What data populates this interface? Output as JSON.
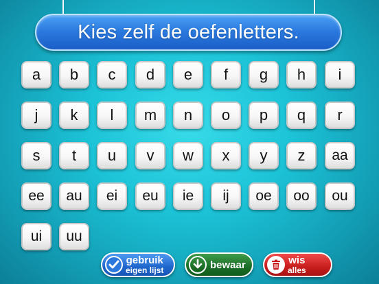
{
  "title": "Kies zelf de oefenletters.",
  "letters": [
    [
      "a",
      "b",
      "c",
      "d",
      "e",
      "f",
      "g",
      "h",
      "i"
    ],
    [
      "j",
      "k",
      "l",
      "m",
      "n",
      "o",
      "p",
      "q",
      "r"
    ],
    [
      "s",
      "t",
      "u",
      "v",
      "w",
      "x",
      "y",
      "z",
      "aa"
    ],
    [
      "ee",
      "au",
      "ei",
      "eu",
      "ie",
      "ij",
      "oe",
      "oo",
      "ou"
    ],
    [
      "ui",
      "uu"
    ]
  ],
  "buttons": {
    "use_list": {
      "line1": "gebruik",
      "line2": "eigen lijst",
      "icon": "checkmark-icon",
      "color": "#1f66cc"
    },
    "save": {
      "label": "bewaar",
      "icon": "download-icon",
      "color": "#1b6e27"
    },
    "clear": {
      "line1": "wis",
      "line2": "alles",
      "icon": "trash-icon",
      "color": "#c81d1d"
    }
  }
}
